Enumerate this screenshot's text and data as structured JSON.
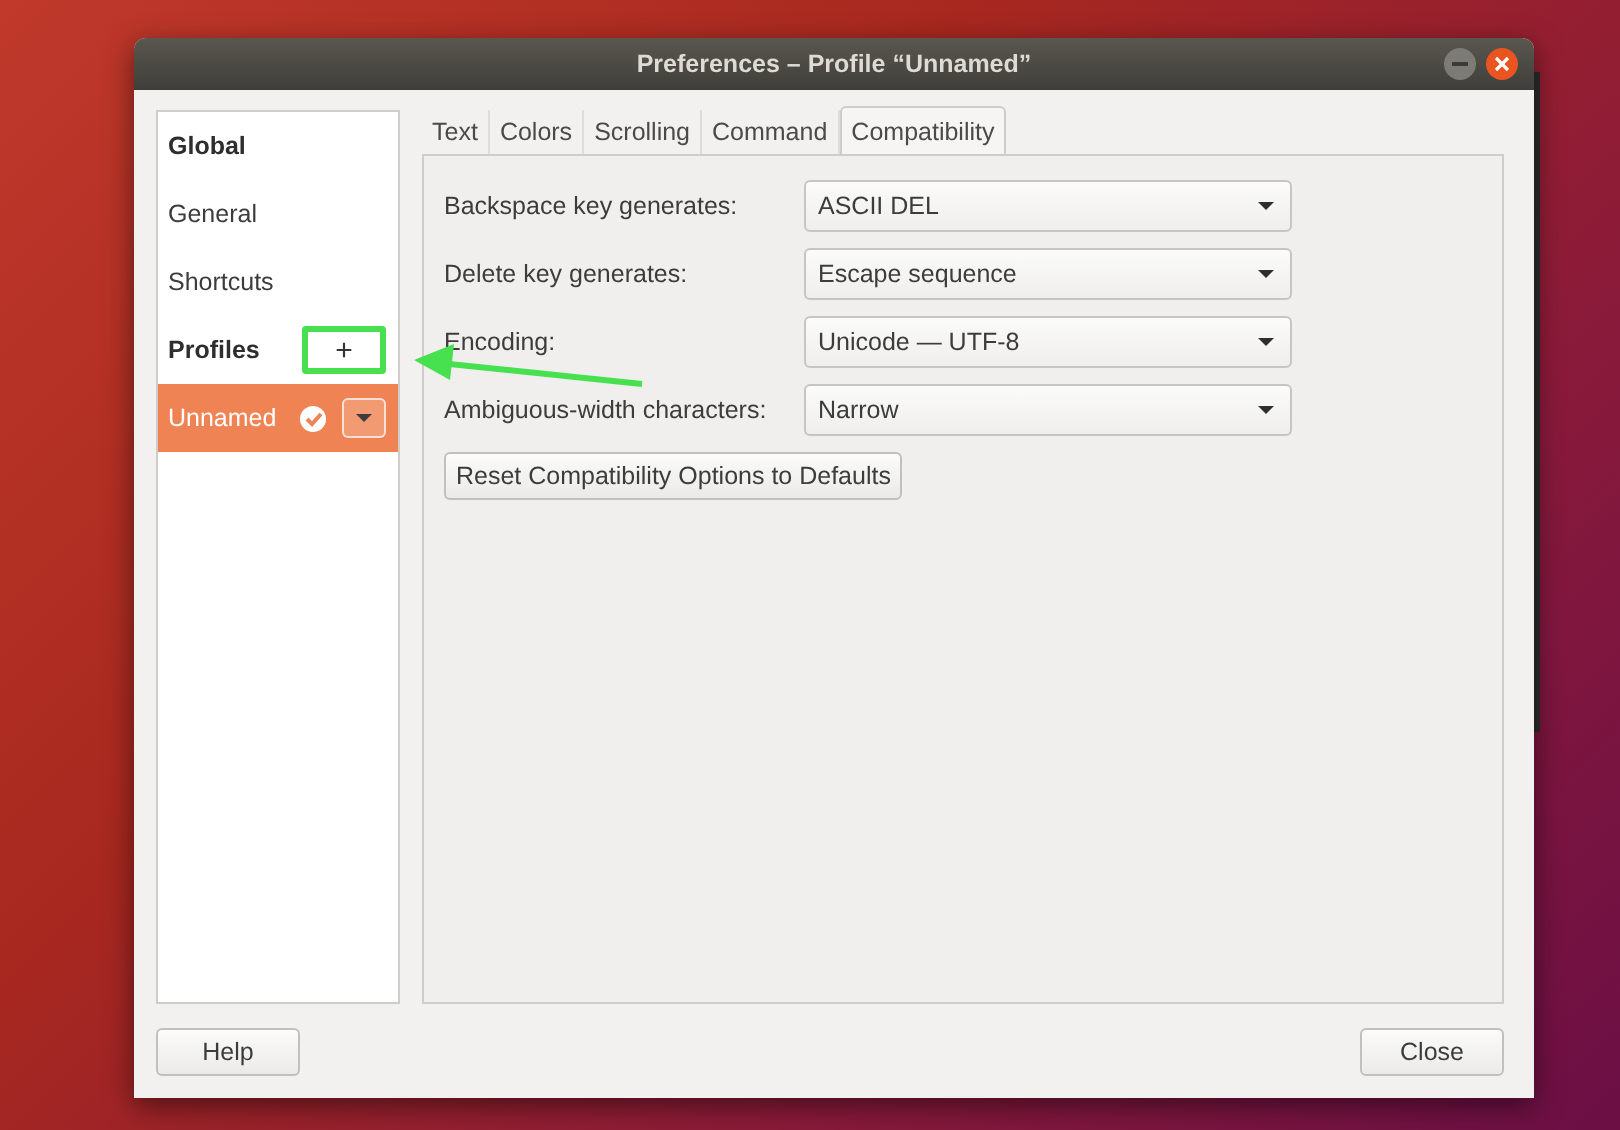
{
  "window": {
    "title": "Preferences – Profile “Unnamed”"
  },
  "sidebar": {
    "items": [
      {
        "kind": "heading",
        "label": "Global"
      },
      {
        "kind": "item",
        "label": "General",
        "selected": false
      },
      {
        "kind": "item",
        "label": "Shortcuts",
        "selected": false
      },
      {
        "kind": "heading",
        "label": "Profiles",
        "add_button": {
          "label": "+",
          "highlighted": true
        }
      },
      {
        "kind": "profile",
        "label": "Unnamed",
        "selected": true,
        "default": true
      }
    ]
  },
  "tabs": [
    {
      "label": "Text",
      "selected": false
    },
    {
      "label": "Colors",
      "selected": false
    },
    {
      "label": "Scrolling",
      "selected": false
    },
    {
      "label": "Command",
      "selected": false
    },
    {
      "label": "Compatibility",
      "selected": true
    }
  ],
  "settings": [
    {
      "label": "Backspace key generates:",
      "value": "ASCII DEL"
    },
    {
      "label": "Delete key generates:",
      "value": "Escape sequence"
    },
    {
      "label": "Encoding:",
      "value": "Unicode — UTF-8"
    },
    {
      "label": "Ambiguous-width characters:",
      "value": "Narrow"
    }
  ],
  "reset_button": "Reset Compatibility Options to Defaults",
  "buttons": {
    "help": "Help",
    "close": "Close"
  }
}
